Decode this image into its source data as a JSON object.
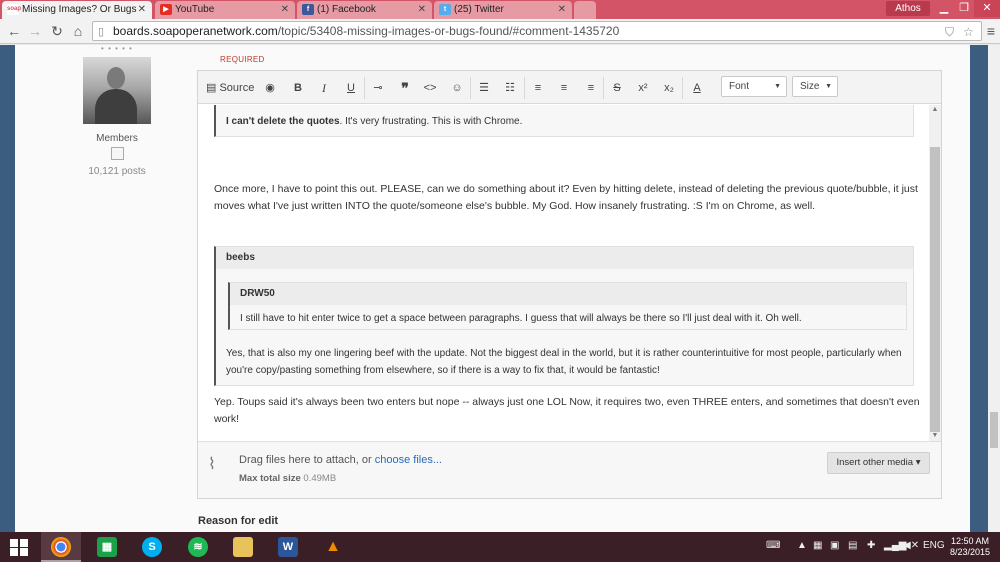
{
  "browser": {
    "tabs": [
      {
        "title": "Missing Images? Or Bugs",
        "favicon": "soap",
        "active": true
      },
      {
        "title": "YouTube",
        "favicon": "youtube",
        "active": false
      },
      {
        "title": "(1) Facebook",
        "favicon": "facebook",
        "active": false
      },
      {
        "title": "(25) Twitter",
        "favicon": "twitter",
        "active": false
      }
    ],
    "profile_name": "Athos",
    "url_host": "boards.soapoperanetwork.com",
    "url_path": "/topic/53408-missing-images-or-bugs-found/#comment-1435720"
  },
  "author": {
    "group": "Members",
    "post_count": "10,121 posts"
  },
  "editor": {
    "required_label": "REQUIRED",
    "toolbar": {
      "source_label": "Source",
      "font_label": "Font",
      "size_label": "Size"
    },
    "content": {
      "quote1_text_bold": "I can't delete the quotes",
      "quote1_text_rest": ". It's very frustrating. This is with Chrome.",
      "paragraph1": "Once more, I have to point this out. PLEASE, can we do something about it? Even by hitting delete, instead of deleting the previous quote/bubble, it just moves what I've just written INTO the quote/someone else's bubble. My God. How insanely frustrating. :S I'm on Chrome, as well.",
      "quote2_cite": "beebs",
      "quote3_cite": "DRW50",
      "quote3_text": "I still have to hit enter twice to get a space between paragraphs. I guess that will always be there so I'll just deal with it. Oh well.",
      "quote2_text": "Yes, that is also my one lingering beef with the update. Not the biggest deal in the world, but it is rather counterintuitive for most people, particularly when you're copy/pasting something from elsewhere, so if there is a way to fix that, it would be fantastic!",
      "paragraph2": "Yep. Toups said it's always been two enters but nope -- always just one LOL Now, it requires two, even THREE enters, and sometimes that doesn't even work!"
    },
    "attach": {
      "drag_text": "Drag files here to attach, or ",
      "choose_link": "choose files...",
      "max_label": "Max total size",
      "max_value": "0.49MB",
      "insert_media_label": "Insert other media ▾"
    }
  },
  "reason_label": "Reason for edit",
  "taskbar": {
    "language": "ENG",
    "time": "12:50 AM",
    "date": "8/23/2015",
    "word_icon_label": "W"
  },
  "colors": {
    "tab_strip": "#d35466",
    "page_rail": "#3a5d80",
    "taskbar": "#3a1f27",
    "required": "#c0392b",
    "link": "#2a6ab5"
  }
}
